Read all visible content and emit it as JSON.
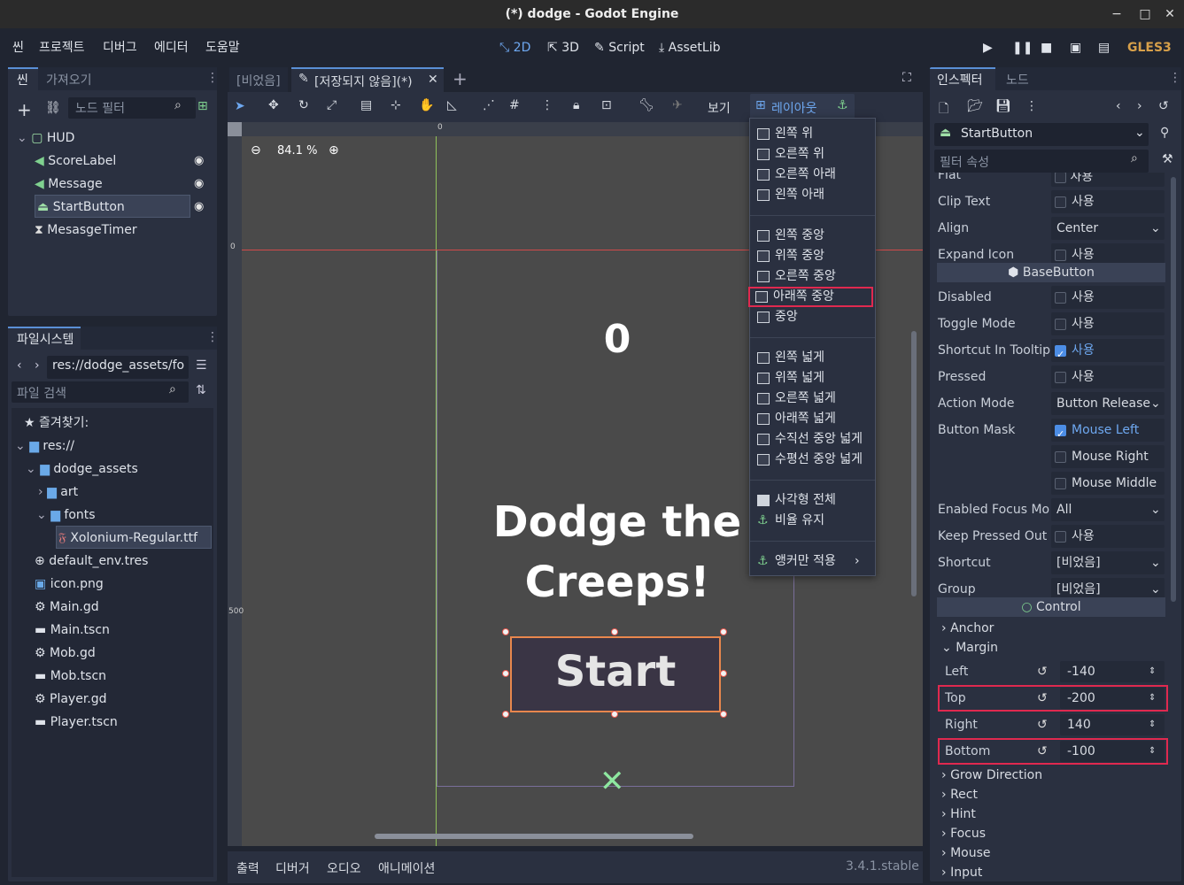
{
  "window": {
    "title": "(*) dodge - Godot Engine",
    "minimize": "−",
    "maximize": "□",
    "close": "✕"
  },
  "menu": {
    "items": [
      "씬",
      "프로젝트",
      "디버그",
      "에디터",
      "도움말"
    ]
  },
  "modes": {
    "m2d": "2D",
    "m3d": "3D",
    "script": "Script",
    "assetlib": "AssetLib",
    "renderer": "GLES3"
  },
  "scene_dock": {
    "tab_scene": "씬",
    "tab_import": "가져오기",
    "filter_placeholder": "노드 필터",
    "nodes": [
      {
        "name": "HUD",
        "icon": "control-icon"
      },
      {
        "name": "ScoreLabel",
        "icon": "label-icon"
      },
      {
        "name": "Message",
        "icon": "label-icon"
      },
      {
        "name": "StartButton",
        "icon": "button-icon"
      },
      {
        "name": "MesasgeTimer",
        "icon": "timer-icon"
      }
    ]
  },
  "filesystem": {
    "tab": "파일시스템",
    "path": "res://dodge_assets/fo",
    "search_placeholder": "파일 검색",
    "items": [
      {
        "name": "즐겨찾기:"
      },
      {
        "name": "res://"
      },
      {
        "name": "dodge_assets"
      },
      {
        "name": "art"
      },
      {
        "name": "fonts"
      },
      {
        "name": "Xolonium-Regular.ttf"
      },
      {
        "name": "default_env.tres"
      },
      {
        "name": "icon.png"
      },
      {
        "name": "Main.gd"
      },
      {
        "name": "Main.tscn"
      },
      {
        "name": "Mob.gd"
      },
      {
        "name": "Mob.tscn"
      },
      {
        "name": "Player.gd"
      },
      {
        "name": "Player.tscn"
      }
    ]
  },
  "editor_tabs": {
    "empty": "[비었음]",
    "unsaved": "[저장되지 않음](*)"
  },
  "toolbar": {
    "view": "보기",
    "layout": "레이아웃"
  },
  "viewport": {
    "zoom": "84.1 %",
    "score": "0",
    "message_line1": "Dodge the",
    "message_line2": "Creeps!",
    "button_text": "Start",
    "ruler_0": "0",
    "ruler_500": "500"
  },
  "layout_menu": {
    "groups": [
      [
        "왼쪽 위",
        "오른쪽 위",
        "오른쪽 아래",
        "왼쪽 아래"
      ],
      [
        "왼쪽 중앙",
        "위쪽 중앙",
        "오른쪽 중앙",
        "아래쪽 중앙",
        "중앙"
      ],
      [
        "왼쪽 넓게",
        "위쪽 넓게",
        "오른쪽 넓게",
        "아래쪽 넓게",
        "수직선 중앙 넓게",
        "수평선 중앙 넓게"
      ],
      [
        "사각형 전체",
        "비율 유지"
      ],
      [
        "앵커만 적용"
      ]
    ],
    "highlighted": "아래쪽 중앙"
  },
  "bottom_panel": {
    "output": "출력",
    "debugger": "디버거",
    "audio": "오디오",
    "animation": "애니메이션",
    "version": "3.4.1.stable"
  },
  "inspector": {
    "tab_inspector": "인스펙터",
    "tab_node": "노드",
    "object": "StartButton",
    "filter_placeholder": "필터 속성",
    "on_label": "사용",
    "flat_label": "Flat",
    "props": [
      {
        "label": "Clip Text",
        "type": "check",
        "checked": false
      },
      {
        "label": "Align",
        "type": "enum",
        "value": "Center"
      },
      {
        "label": "Expand Icon",
        "type": "check",
        "checked": false
      }
    ],
    "section_basebutton": "BaseButton",
    "props2": [
      {
        "label": "Disabled",
        "type": "check",
        "checked": false
      },
      {
        "label": "Toggle Mode",
        "type": "check",
        "checked": false
      },
      {
        "label": "Shortcut In Tooltip",
        "type": "check",
        "checked": true
      },
      {
        "label": "Pressed",
        "type": "check",
        "checked": false
      },
      {
        "label": "Action Mode",
        "type": "enum",
        "value": "Button Release"
      }
    ],
    "button_mask_label": "Button Mask",
    "button_mask": [
      {
        "label": "Mouse Left",
        "checked": true
      },
      {
        "label": "Mouse Right",
        "checked": false
      },
      {
        "label": "Mouse Middle",
        "checked": false
      }
    ],
    "props3": [
      {
        "label": "Enabled Focus Mo",
        "type": "enum",
        "value": "All"
      },
      {
        "label": "Keep Pressed Out",
        "type": "check",
        "checked": false
      },
      {
        "label": "Shortcut",
        "type": "enum",
        "value": "[비었음]"
      },
      {
        "label": "Group",
        "type": "enum",
        "value": "[비었음]"
      }
    ],
    "section_control": "Control",
    "anchor": "Anchor",
    "margin": "Margin",
    "margins": [
      {
        "label": "Left",
        "value": "-140"
      },
      {
        "label": "Top",
        "value": "-200"
      },
      {
        "label": "Right",
        "value": "140"
      },
      {
        "label": "Bottom",
        "value": "-100"
      }
    ],
    "groups": [
      "Grow Direction",
      "Rect",
      "Hint",
      "Focus",
      "Mouse",
      "Input"
    ]
  },
  "colors": {
    "accent": "#4c8de5",
    "highlight": "#e0294f",
    "selection": "#e8874d"
  }
}
